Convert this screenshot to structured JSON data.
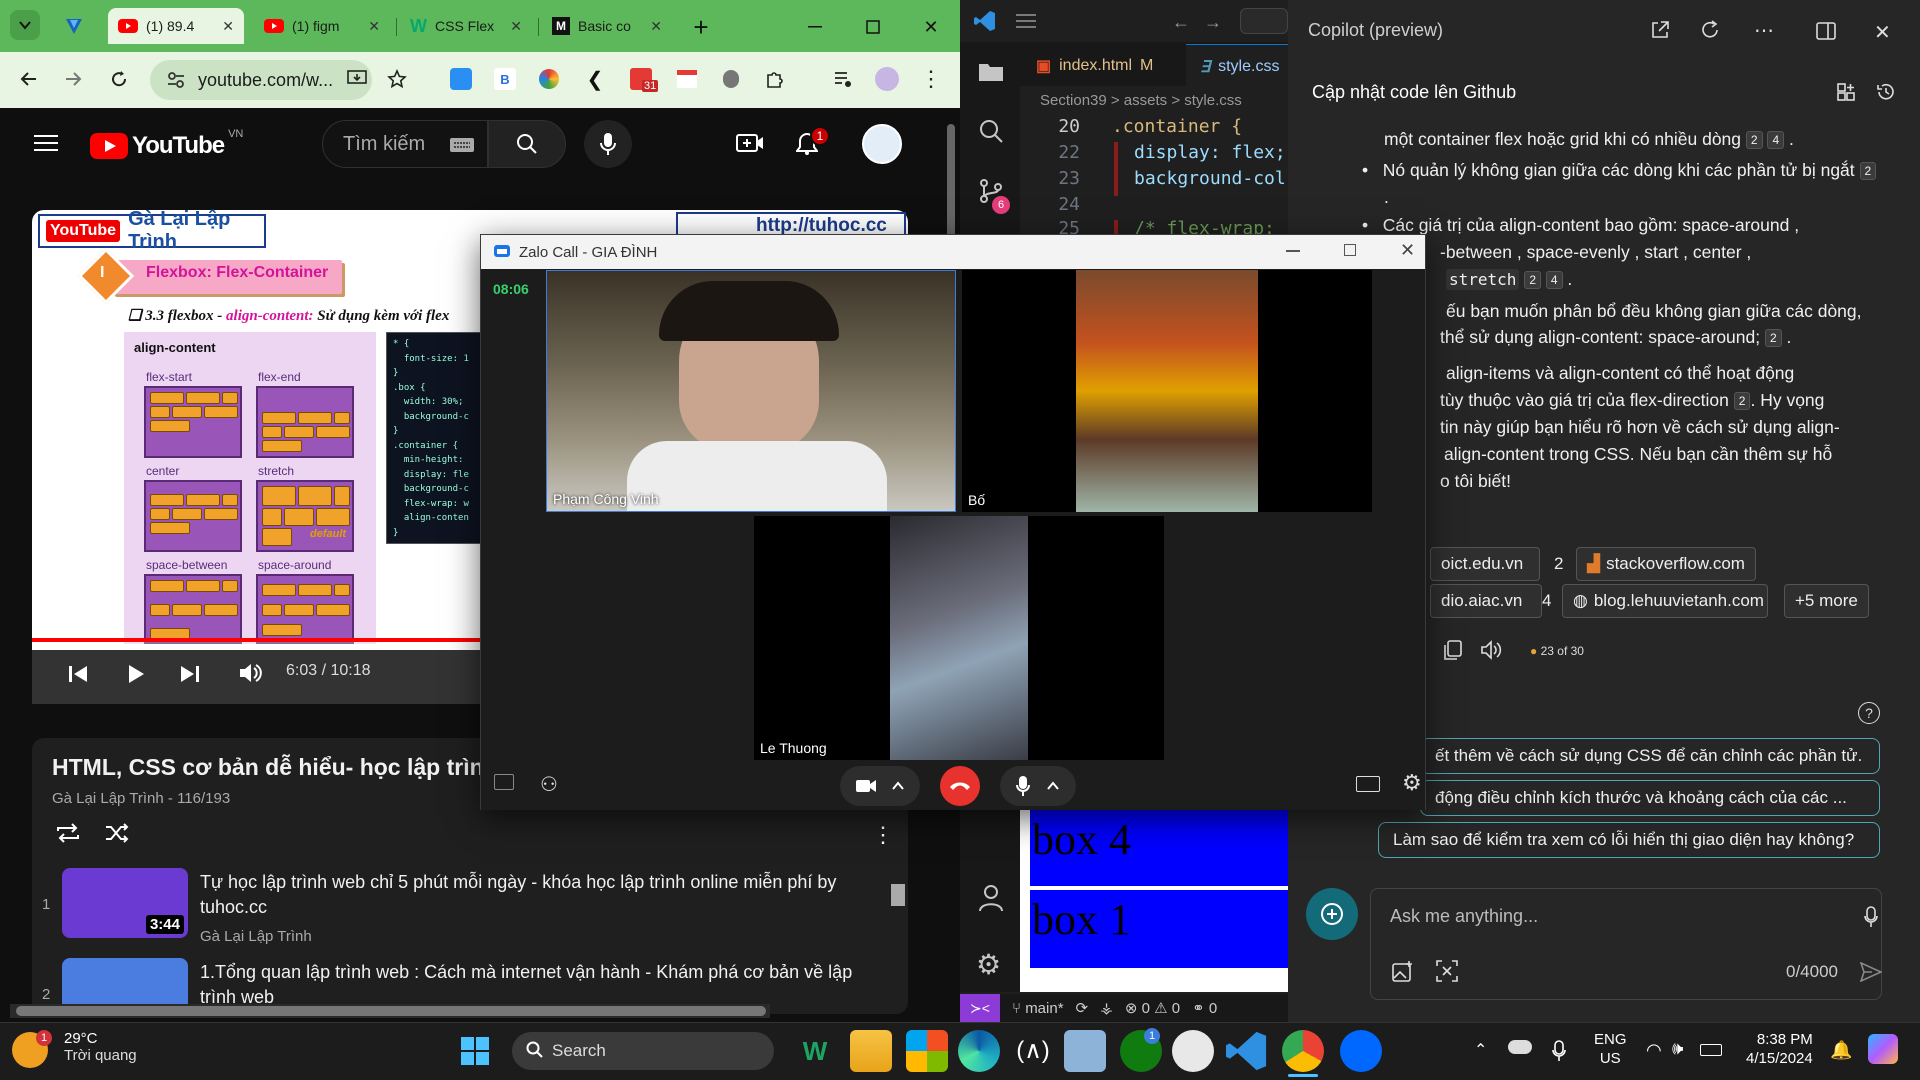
{
  "chrome": {
    "tabs": [
      {
        "title": "(1) 89.4",
        "icon": "youtube-icon"
      },
      {
        "title": "(1) figm",
        "icon": "youtube-icon"
      },
      {
        "title": "CSS Flex",
        "icon": "w3schools-icon"
      },
      {
        "title": "Basic co",
        "icon": "m-icon"
      }
    ],
    "url": "youtube.com/w...",
    "extension_badge": "31"
  },
  "youtube": {
    "logo_text": "YouTube",
    "country": "VN",
    "search_placeholder": "Tìm kiếm",
    "notification_count": "1",
    "slide": {
      "header_logo": "YouTube",
      "header_title": "Gà Lại Lập Trình",
      "url": "http://tuhoc.cc",
      "banner_number": "I",
      "banner": "Flexbox: Flex-Container",
      "subtitle_prefix": "3.3 flexbox - ",
      "subtitle_keyword": "align-content:",
      "subtitle_rest": " Sử dụng kèm với flex",
      "panel_title": "align-content",
      "labels": [
        "flex-start",
        "flex-end",
        "center",
        "stretch",
        "space-between",
        "space-around"
      ],
      "default_label": "default",
      "code": "* {\n  font-size: 1\n}\n.box {\n  width: 30%;\n  background-c\n}\n.container {\n  min-height: \n  display: fle\n  background-c\n  flex-wrap: w\n  align-conten\n}"
    },
    "time": "6:03 / 10:18",
    "progress_fraction": 0.58,
    "video_title": "HTML, CSS cơ bản dễ hiểu- học lập trìn",
    "video_meta": "Gà Lại Lập Trình - 116/193",
    "playlist": [
      {
        "num": "1",
        "title": "Tự học lập trình web chỉ 5 phút mỗi ngày - khóa học lập trình online miễn phí by tuhoc.cc",
        "channel": "Gà Lại Lập Trình",
        "duration": "3:44"
      },
      {
        "num": "2",
        "title": "1.Tổng quan lập trình web : Cách mà internet vận hành - Khám phá cơ bản về lập trình web",
        "channel": "",
        "duration": ""
      }
    ]
  },
  "vscode": {
    "tabs": [
      {
        "label": "index.html",
        "status": "M"
      },
      {
        "label": "style.css",
        "status": ""
      }
    ],
    "breadcrumb": "Section39 > assets > style.css",
    "source_control_badge": "6",
    "lines": [
      {
        "num": "20",
        "text": ".container {"
      },
      {
        "num": "22",
        "text": "display: flex;"
      },
      {
        "num": "23",
        "text": "background-col"
      },
      {
        "num": "24",
        "text": ""
      },
      {
        "num": "25",
        "text": "/* flex-wrap:"
      }
    ],
    "preview_boxes": [
      "box 4",
      "box 1"
    ],
    "status": {
      "branch": "main*",
      "errors": "0",
      "warnings": "0",
      "ports": "0"
    }
  },
  "copilot": {
    "title": "Copilot (preview)",
    "conversation": "Cập nhật code lên Github",
    "lines": [
      {
        "text": "một container flex hoặc grid khi có nhiều dòng",
        "cites": [
          "2",
          "4"
        ]
      },
      {
        "text": "Nó quản lý không gian giữa các dòng khi các phần tử bị ngắt",
        "cites": [
          "2"
        ]
      },
      {
        "text": "Các giá trị của align-content bao gồm: space-around ,",
        "cites": []
      },
      {
        "text": "-between , space-evenly , start , center ,",
        "cites": []
      },
      {
        "text": "stretch",
        "cites": [
          "2",
          "4"
        ]
      },
      {
        "text": "ếu bạn muốn phân bổ đều không gian giữa các dòng,",
        "cites": []
      },
      {
        "text": "thể sử dụng align-content: space-around;",
        "cites": [
          "2"
        ]
      },
      {
        "text": "align-items và align-content có thể hoạt động",
        "cites": []
      },
      {
        "text": "tùy thuộc vào giá trị của flex-direction",
        "cites": [
          "2"
        ],
        "tail": ". Hy vọng"
      },
      {
        "text": "tin này giúp bạn hiểu rõ hơn về cách sử dụng align-",
        "cites": []
      },
      {
        "text": "align-content trong CSS. Nếu bạn cần thêm sự hỗ",
        "cites": []
      },
      {
        "text": "o tôi biết!",
        "cites": []
      }
    ],
    "sources": [
      {
        "num": "",
        "label": "oict.edu.vn"
      },
      {
        "num": "2",
        "label": "stackoverflow.com"
      },
      {
        "num": "",
        "label": "dio.aiac.vn"
      },
      {
        "num": "4",
        "label": "blog.lehuuvietanh.com"
      }
    ],
    "more_sources": "+5 more",
    "turn_counter": "23 of 30",
    "suggestions": [
      "ết thêm về cách sử dụng CSS để căn chỉnh các phần tử.",
      "động điều chỉnh kích thước và khoảng cách của các ...",
      "Làm sao để kiểm tra xem có lỗi hiển thị giao diện hay không?"
    ],
    "input_placeholder": "Ask me anything...",
    "char_count": "0/4000"
  },
  "zalo": {
    "title": "Zalo Call - GIA ĐÌNH",
    "timer": "08:06",
    "participants": [
      "Phạm Công Vinh",
      "Bố",
      "Le Thuong"
    ]
  },
  "taskbar": {
    "weather_badge": "1",
    "temperature": "29°C",
    "weather_desc": "Trời quang",
    "search_label": "Search",
    "xbox_badge": "1",
    "lang_top": "ENG",
    "lang_bottom": "US",
    "time": "8:38 PM",
    "date": "4/15/2024"
  }
}
